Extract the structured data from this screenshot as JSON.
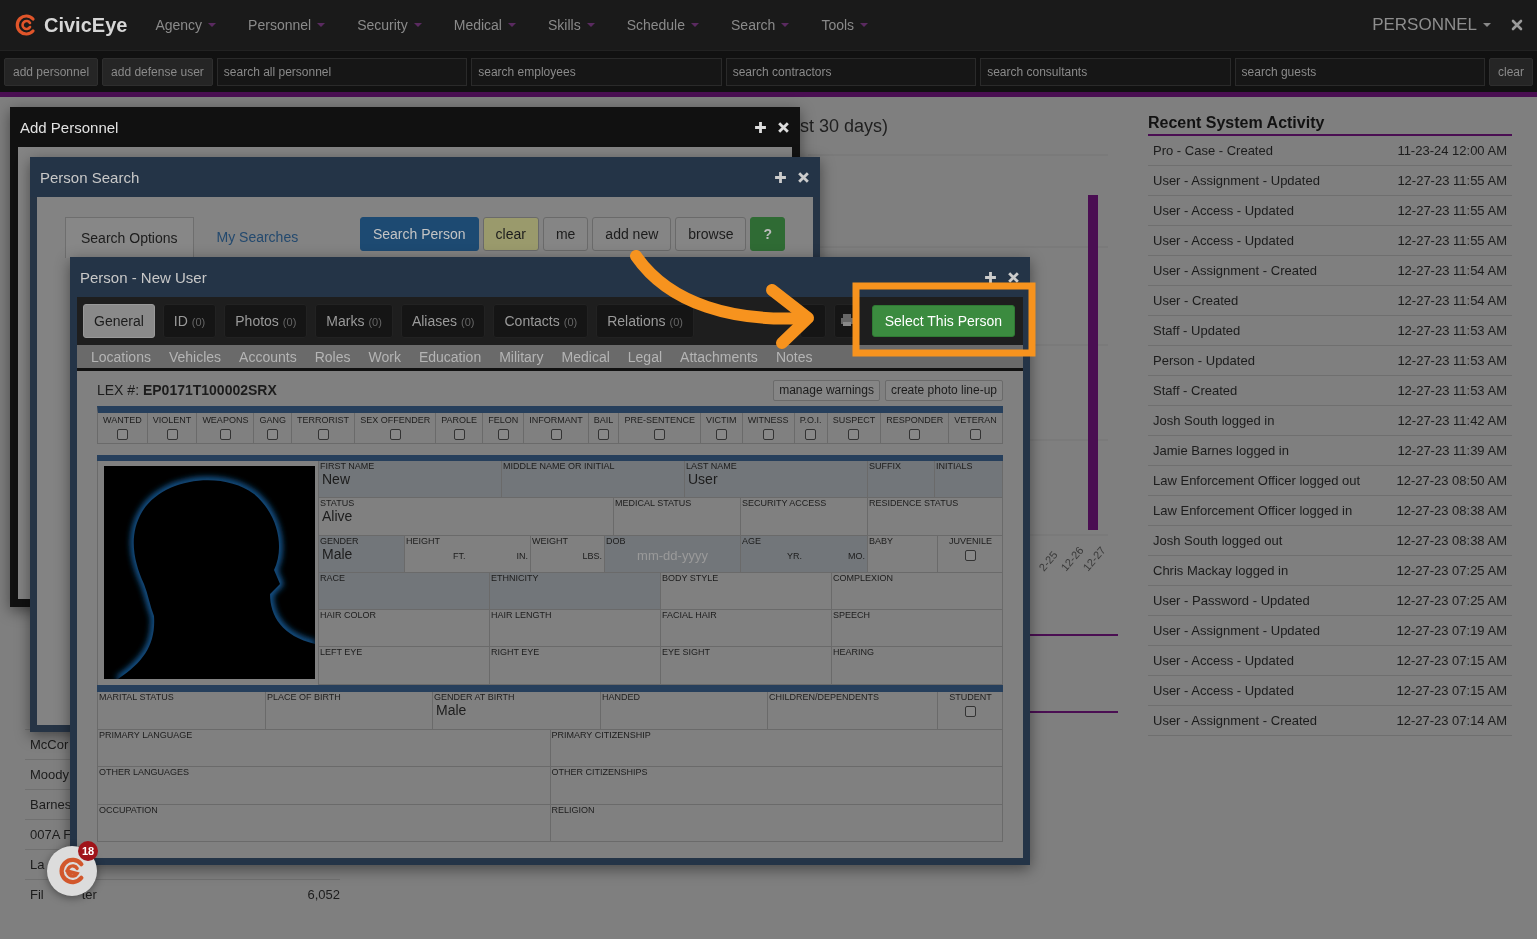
{
  "nav": {
    "brand": "CivicEye",
    "menu": [
      "Agency",
      "Personnel",
      "Security",
      "Medical",
      "Skills",
      "Schedule",
      "Search",
      "Tools"
    ],
    "module": "PERSONNEL"
  },
  "toolbar": {
    "buttons": [
      "add personnel",
      "add defense user"
    ],
    "searches": [
      {
        "placeholder": "search all personnel"
      },
      {
        "placeholder": "search employees"
      },
      {
        "placeholder": "search contractors"
      },
      {
        "placeholder": "search consultants"
      },
      {
        "placeholder": "search guests"
      }
    ],
    "clear": "clear"
  },
  "background": {
    "title_fragment": "st 30 days)",
    "chart_dates": [
      "2-25",
      "12-26",
      "12-27"
    ],
    "list": [
      {
        "label": "McCor"
      },
      {
        "label": "Moody"
      },
      {
        "label": "Barnes"
      },
      {
        "label": "007A F"
      },
      {
        "label": "La"
      },
      {
        "label": "Fil",
        "label_tail": "ter",
        "value": "6,052"
      }
    ]
  },
  "activity": {
    "title": "Recent System Activity",
    "rows": [
      {
        "event": "Pro - Case - Created",
        "time": "11-23-24 12:00 AM"
      },
      {
        "event": "User - Assignment - Updated",
        "time": "12-27-23 11:55 AM"
      },
      {
        "event": "User - Access - Updated",
        "time": "12-27-23 11:55 AM"
      },
      {
        "event": "User - Access - Updated",
        "time": "12-27-23 11:55 AM"
      },
      {
        "event": "User - Assignment - Created",
        "time": "12-27-23 11:54 AM"
      },
      {
        "event": "User - Created",
        "time": "12-27-23 11:54 AM"
      },
      {
        "event": "Staff - Updated",
        "time": "12-27-23 11:53 AM"
      },
      {
        "event": "Person - Updated",
        "time": "12-27-23 11:53 AM"
      },
      {
        "event": "Staff - Created",
        "time": "12-27-23 11:53 AM"
      },
      {
        "event": "Josh South logged in",
        "time": "12-27-23 11:42 AM"
      },
      {
        "event": "Jamie Barnes logged in",
        "time": "12-27-23 11:39 AM"
      },
      {
        "event": "Law Enforcement Officer logged out",
        "time": "12-27-23 08:50 AM"
      },
      {
        "event": "Law Enforcement Officer logged in",
        "time": "12-27-23 08:38 AM"
      },
      {
        "event": "Josh South logged out",
        "time": "12-27-23 08:38 AM"
      },
      {
        "event": "Chris Mackay logged in",
        "time": "12-27-23 07:25 AM"
      },
      {
        "event": "User - Password - Updated",
        "time": "12-27-23 07:25 AM"
      },
      {
        "event": "User - Assignment - Updated",
        "time": "12-27-23 07:19 AM"
      },
      {
        "event": "User - Access - Updated",
        "time": "12-27-23 07:15 AM"
      },
      {
        "event": "User - Access - Updated",
        "time": "12-27-23 07:15 AM"
      },
      {
        "event": "User - Assignment - Created",
        "time": "12-27-23 07:14 AM"
      }
    ]
  },
  "add_personnel": {
    "title": "Add Personnel"
  },
  "person_search": {
    "title": "Person Search",
    "tabs": [
      {
        "label": "Search Options",
        "selected": true
      },
      {
        "label": "My Searches",
        "selected": false
      }
    ],
    "buttons": [
      {
        "label": "Search Person",
        "kind": "primary"
      },
      {
        "label": "clear",
        "kind": "warning"
      },
      {
        "label": "me",
        "kind": "default"
      },
      {
        "label": "add new",
        "kind": "default"
      },
      {
        "label": "browse",
        "kind": "default"
      },
      {
        "label": "?",
        "kind": "success"
      }
    ]
  },
  "person": {
    "title": "Person - New User",
    "tabs": [
      {
        "label": "General",
        "selected": true
      },
      {
        "label": "ID",
        "count": "(0)",
        "selected": false
      },
      {
        "label": "Photos",
        "count": "(0)",
        "selected": false
      },
      {
        "label": "Marks",
        "count": "(0)",
        "selected": false
      },
      {
        "label": "Aliases",
        "count": "(0)",
        "selected": false
      },
      {
        "label": "Contacts",
        "count": "(0)",
        "selected": false
      },
      {
        "label": "Relations",
        "count": "(0)",
        "selected": false
      }
    ],
    "tools": [
      {
        "kind": "covered"
      },
      {
        "kind": "print"
      },
      {
        "kind": "select",
        "label": "Select This Person"
      }
    ],
    "subtabs": [
      {
        "label": "Locations",
        "disabled": true
      },
      {
        "label": "Vehicles",
        "disabled": true
      },
      {
        "label": "Accounts",
        "disabled": true
      },
      {
        "label": "Roles",
        "disabled": true
      },
      {
        "label": "Work",
        "disabled": true
      },
      {
        "label": "Education",
        "disabled": true
      },
      {
        "label": "Military",
        "disabled": true
      },
      {
        "label": "Medical",
        "disabled": true
      },
      {
        "label": "Legal",
        "disabled": true
      },
      {
        "label": "Attachments",
        "disabled": true
      },
      {
        "label": "Notes",
        "disabled": true
      }
    ],
    "lex": {
      "label": "LEX #:",
      "value": "EP0171T100002SRX"
    },
    "actions": [
      "manage warnings",
      "create photo line-up"
    ],
    "flags": [
      {
        "label": "WANTED",
        "checked": false
      },
      {
        "label": "VIOLENT",
        "checked": false
      },
      {
        "label": "WEAPONS",
        "checked": false
      },
      {
        "label": "GANG",
        "checked": false
      },
      {
        "label": "TERRORIST",
        "checked": false
      },
      {
        "label": "SEX OFFENDER",
        "checked": false
      },
      {
        "label": "PAROLE",
        "checked": false
      },
      {
        "label": "FELON",
        "checked": false
      },
      {
        "label": "INFORMANT",
        "checked": false
      },
      {
        "label": "BAIL",
        "checked": false
      },
      {
        "label": "PRE-SENTENCE",
        "checked": false
      },
      {
        "label": "VICTIM",
        "checked": false
      },
      {
        "label": "WITNESS",
        "checked": false
      },
      {
        "label": "P.O.I.",
        "checked": false
      },
      {
        "label": "SUSPECT",
        "checked": false
      },
      {
        "label": "RESPONDER",
        "checked": false
      },
      {
        "label": "VETERAN",
        "checked": false
      }
    ],
    "identity": [
      [
        {
          "kind": "text",
          "label": "FIRST NAME",
          "value": "New",
          "required": true
        },
        {
          "kind": "text",
          "label": "MIDDLE NAME OR INITIAL",
          "required": true
        },
        {
          "kind": "text",
          "label": "LAST NAME",
          "value": "User",
          "required": true
        },
        {
          "kind": "text",
          "label": "SUFFIX",
          "required": true
        },
        {
          "kind": "text",
          "label": "INITIALS",
          "required": true
        }
      ],
      [
        {
          "kind": "text",
          "label": "STATUS",
          "value": "Alive",
          "required": false
        },
        {
          "kind": "text",
          "label": "MEDICAL STATUS",
          "required": false
        },
        {
          "kind": "text",
          "label": "SECURITY ACCESS",
          "required": false
        },
        {
          "kind": "text",
          "label": "RESIDENCE STATUS",
          "required": false
        }
      ],
      [
        {
          "kind": "text",
          "label": "GENDER",
          "value": "Male",
          "required": true
        },
        {
          "kind": "measure",
          "label": "HEIGHT",
          "units": [
            "FT.",
            "IN."
          ],
          "required": false
        },
        {
          "kind": "measure",
          "label": "WEIGHT",
          "units": [
            "LBS."
          ],
          "required": false
        },
        {
          "kind": "date",
          "label": "DOB",
          "placeholder": "mm-dd-yyyy",
          "required": true
        },
        {
          "kind": "measure",
          "label": "AGE",
          "units": [
            "YR.",
            "MO."
          ],
          "required": true
        },
        {
          "kind": "text",
          "label": "BABY",
          "required": false
        },
        {
          "kind": "check",
          "label": "JUVENILE",
          "checked": false,
          "required": false
        }
      ],
      [
        {
          "kind": "text",
          "label": "RACE",
          "required": true
        },
        {
          "kind": "text",
          "label": "ETHNICITY",
          "required": true
        },
        {
          "kind": "text",
          "label": "BODY STYLE",
          "required": false
        },
        {
          "kind": "text",
          "label": "COMPLEXION",
          "required": false
        }
      ],
      [
        {
          "kind": "text",
          "label": "HAIR COLOR",
          "required": false
        },
        {
          "kind": "text",
          "label": "HAIR LENGTH",
          "required": false
        },
        {
          "kind": "text",
          "label": "FACIAL HAIR",
          "required": false
        },
        {
          "kind": "text",
          "label": "SPEECH",
          "required": false
        }
      ],
      [
        {
          "kind": "text",
          "label": "LEFT EYE",
          "required": false
        },
        {
          "kind": "text",
          "label": "RIGHT EYE",
          "required": false
        },
        {
          "kind": "text",
          "label": "EYE SIGHT",
          "required": false
        },
        {
          "kind": "text",
          "label": "HEARING",
          "required": false
        }
      ]
    ],
    "details": [
      [
        {
          "kind": "text",
          "label": "MARITAL STATUS",
          "required": false
        },
        {
          "kind": "text",
          "label": "PLACE OF BIRTH",
          "required": false
        },
        {
          "kind": "text",
          "label": "GENDER AT BIRTH",
          "value": "Male",
          "required": false
        },
        {
          "kind": "text",
          "label": "HANDED",
          "required": false
        },
        {
          "kind": "text",
          "label": "CHILDREN/DEPENDENTS",
          "required": false
        },
        {
          "kind": "check",
          "label": "STUDENT",
          "checked": false,
          "required": false
        }
      ],
      [
        {
          "kind": "text",
          "label": "PRIMARY LANGUAGE",
          "required": false
        },
        {
          "kind": "text",
          "label": "PRIMARY CITIZENSHIP",
          "required": false
        }
      ],
      [
        {
          "kind": "text",
          "label": "OTHER LANGUAGES",
          "required": false
        },
        {
          "kind": "text",
          "label": "OTHER CITIZENSHIPS",
          "required": false
        }
      ],
      [
        {
          "kind": "text",
          "label": "OCCUPATION",
          "required": false
        },
        {
          "kind": "text",
          "label": "RELIGION",
          "required": false
        }
      ]
    ]
  },
  "launcher": {
    "badge": "18"
  }
}
